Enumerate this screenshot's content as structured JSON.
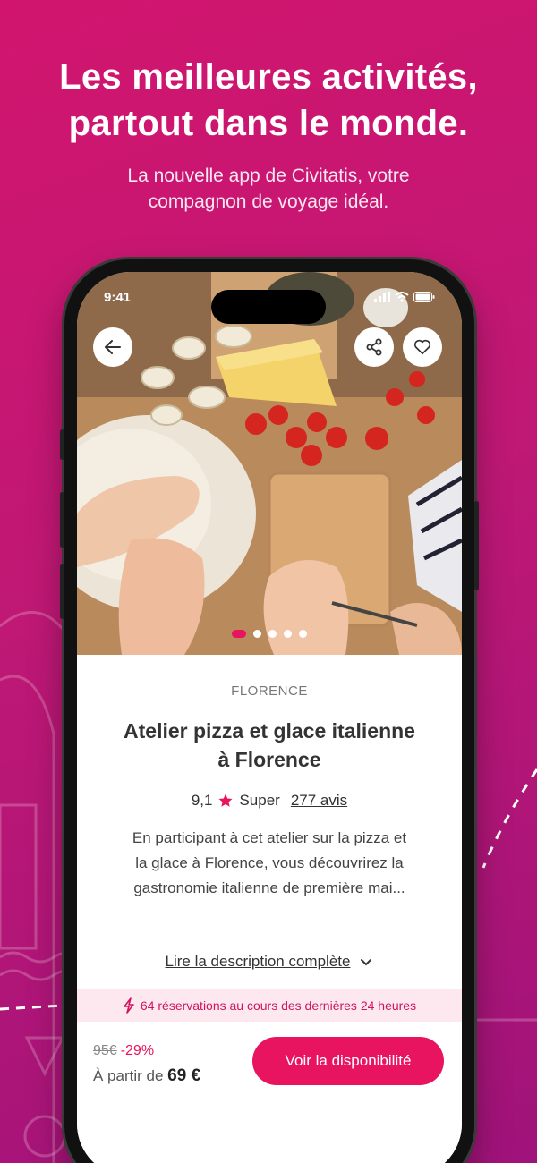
{
  "promo": {
    "headline_line1": "Les meilleures activités,",
    "headline_line2": "partout dans le monde.",
    "subline_line1": "La nouvelle app de Civitatis, votre",
    "subline_line2": "compagnon de voyage idéal."
  },
  "status_bar": {
    "time": "9:41"
  },
  "hero": {
    "carousel_count": 5,
    "carousel_active_index": 0,
    "icons": {
      "back": "arrow-left-icon",
      "share": "share-icon",
      "favorite": "heart-icon"
    }
  },
  "activity": {
    "city": "FLORENCE",
    "title_line1": "Atelier pizza et glace italienne",
    "title_line2": "à Florence",
    "rating": "9,1",
    "rating_label": "Super",
    "reviews": "277 avis",
    "description_line1": "En participant à cet atelier sur la pizza et",
    "description_line2": "la glace à Florence, vous découvrirez la",
    "description_line3": "gastronomie italienne de première mai...",
    "read_more": "Lire la description complète"
  },
  "booking_notice": "64 réservations au cours des dernières 24 heures",
  "pricing": {
    "old_price": "95€",
    "discount": "-29%",
    "from_label": "À partir de",
    "price": "69 €",
    "cta": "Voir la disponibilité"
  },
  "colors": {
    "brand": "#e8145f",
    "background": "#c01875"
  }
}
